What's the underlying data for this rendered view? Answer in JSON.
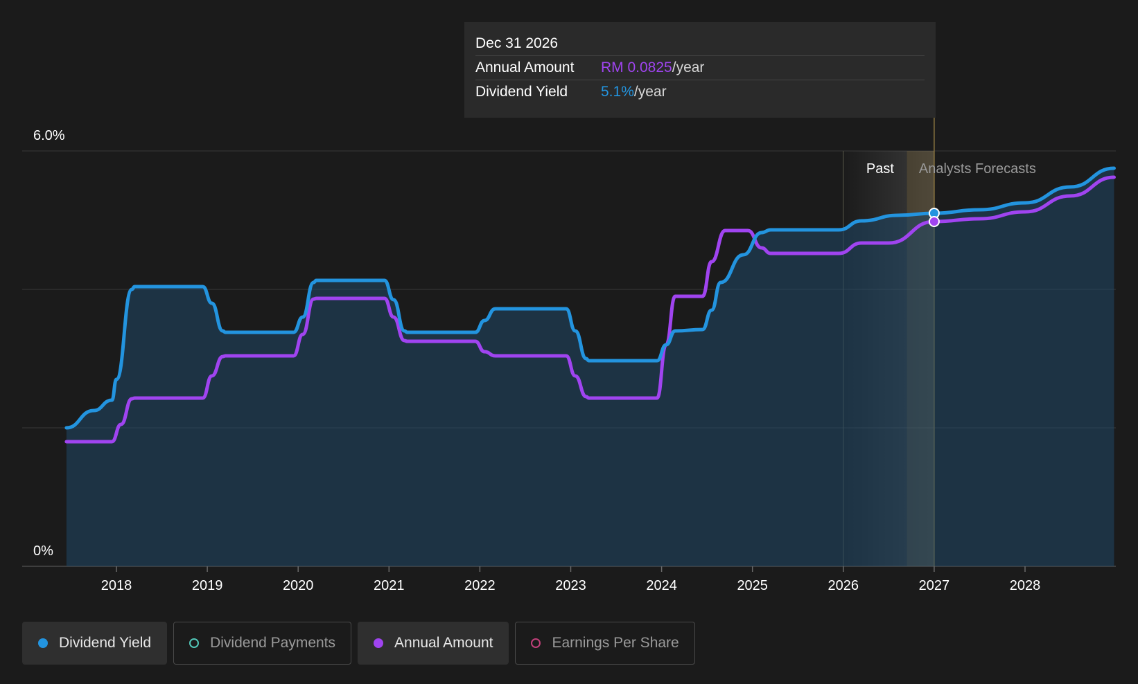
{
  "tooltip": {
    "date": "Dec 31 2026",
    "annual_amount_label": "Annual Amount",
    "annual_amount_value": "RM 0.0825",
    "annual_amount_suffix": "/year",
    "yield_label": "Dividend Yield",
    "yield_value": "5.1%",
    "yield_suffix": "/year"
  },
  "regions": {
    "past_label": "Past",
    "forecast_label": "Analysts Forecasts"
  },
  "legend": [
    {
      "label": "Dividend Yield",
      "active": true,
      "color": "#2394df",
      "marker": "filled"
    },
    {
      "label": "Dividend Payments",
      "active": false,
      "color": "#52c7b8",
      "marker": "hollow"
    },
    {
      "label": "Annual Amount",
      "active": true,
      "color": "#a044f0",
      "marker": "filled"
    },
    {
      "label": "Earnings Per Share",
      "active": false,
      "color": "#c2407a",
      "marker": "hollow"
    }
  ],
  "colors": {
    "background": "#1b1b1b",
    "yield": "#2394df",
    "annual": "#a044f0",
    "grid": "#3a3a3a"
  },
  "chart_data": {
    "type": "line",
    "xlim": [
      2017.45,
      2028.98
    ],
    "ylim": [
      0,
      6.0
    ],
    "y_ticks": [
      "0%",
      "6.0%"
    ],
    "x_ticks": [
      "2018",
      "2019",
      "2020",
      "2021",
      "2022",
      "2023",
      "2024",
      "2025",
      "2026",
      "2027",
      "2028"
    ],
    "past_end": 2026.0,
    "forecast_start": 2027.0,
    "highlight_x": 2027.0,
    "series": [
      {
        "name": "Dividend Yield",
        "color": "#2394df",
        "points": [
          [
            2017.45,
            2.0
          ],
          [
            2017.75,
            2.25
          ],
          [
            2017.95,
            2.4
          ],
          [
            2018.0,
            2.7
          ],
          [
            2018.17,
            4.0
          ],
          [
            2018.2,
            4.04
          ],
          [
            2018.95,
            4.04
          ],
          [
            2019.05,
            3.8
          ],
          [
            2019.17,
            3.4
          ],
          [
            2019.2,
            3.38
          ],
          [
            2019.95,
            3.38
          ],
          [
            2020.05,
            3.6
          ],
          [
            2020.17,
            4.1
          ],
          [
            2020.2,
            4.13
          ],
          [
            2020.95,
            4.13
          ],
          [
            2021.05,
            3.85
          ],
          [
            2021.17,
            3.4
          ],
          [
            2021.2,
            3.38
          ],
          [
            2021.95,
            3.38
          ],
          [
            2022.05,
            3.55
          ],
          [
            2022.17,
            3.72
          ],
          [
            2022.95,
            3.72
          ],
          [
            2023.05,
            3.4
          ],
          [
            2023.17,
            3.0
          ],
          [
            2023.2,
            2.97
          ],
          [
            2023.95,
            2.97
          ],
          [
            2024.05,
            3.2
          ],
          [
            2024.15,
            3.4
          ],
          [
            2024.45,
            3.42
          ],
          [
            2024.55,
            3.7
          ],
          [
            2024.65,
            4.1
          ],
          [
            2024.9,
            4.5
          ],
          [
            2025.1,
            4.82
          ],
          [
            2025.2,
            4.86
          ],
          [
            2025.95,
            4.86
          ],
          [
            2026.2,
            4.99
          ],
          [
            2026.6,
            5.07
          ],
          [
            2027.0,
            5.1
          ],
          [
            2027.5,
            5.15
          ],
          [
            2028.0,
            5.25
          ],
          [
            2028.5,
            5.48
          ],
          [
            2028.98,
            5.75
          ]
        ]
      },
      {
        "name": "Annual Amount",
        "color": "#a044f0",
        "points": [
          [
            2017.45,
            1.8
          ],
          [
            2017.95,
            1.8
          ],
          [
            2018.05,
            2.05
          ],
          [
            2018.17,
            2.42
          ],
          [
            2018.2,
            2.43
          ],
          [
            2018.95,
            2.43
          ],
          [
            2019.05,
            2.75
          ],
          [
            2019.17,
            3.03
          ],
          [
            2019.2,
            3.04
          ],
          [
            2019.95,
            3.04
          ],
          [
            2020.05,
            3.35
          ],
          [
            2020.17,
            3.86
          ],
          [
            2020.2,
            3.87
          ],
          [
            2020.95,
            3.87
          ],
          [
            2021.05,
            3.6
          ],
          [
            2021.17,
            3.26
          ],
          [
            2021.2,
            3.25
          ],
          [
            2021.95,
            3.25
          ],
          [
            2022.05,
            3.1
          ],
          [
            2022.17,
            3.04
          ],
          [
            2022.95,
            3.04
          ],
          [
            2023.05,
            2.75
          ],
          [
            2023.17,
            2.45
          ],
          [
            2023.2,
            2.43
          ],
          [
            2023.95,
            2.43
          ],
          [
            2024.05,
            3.2
          ],
          [
            2024.15,
            3.9
          ],
          [
            2024.45,
            3.9
          ],
          [
            2024.55,
            4.4
          ],
          [
            2024.7,
            4.85
          ],
          [
            2024.95,
            4.85
          ],
          [
            2025.1,
            4.6
          ],
          [
            2025.2,
            4.52
          ],
          [
            2025.95,
            4.52
          ],
          [
            2026.2,
            4.67
          ],
          [
            2026.5,
            4.67
          ],
          [
            2027.0,
            4.98
          ],
          [
            2027.5,
            5.02
          ],
          [
            2028.0,
            5.12
          ],
          [
            2028.5,
            5.35
          ],
          [
            2028.98,
            5.62
          ]
        ]
      }
    ]
  }
}
